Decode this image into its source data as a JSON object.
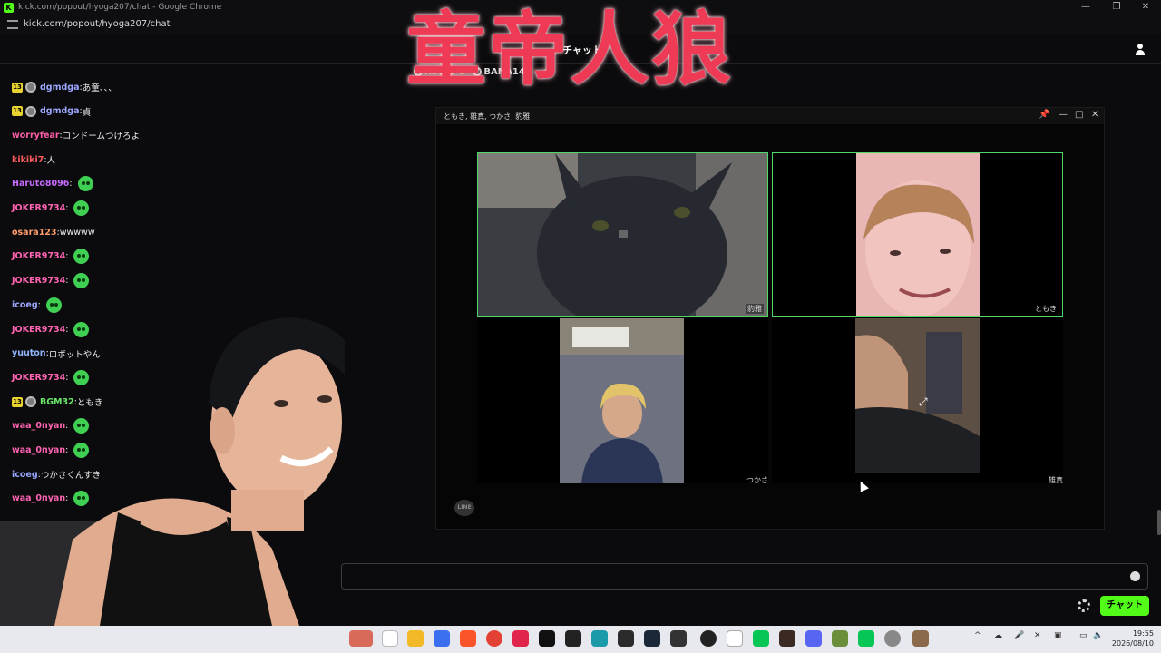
{
  "browser": {
    "window_title": "kick.com/popout/hyoga207/chat - Google Chrome",
    "url": "kick.com/popout/hyoga207/chat"
  },
  "chat_header": {
    "title": "チャット",
    "pinned_users": [
      "RIAKO 5",
      "BANA145"
    ]
  },
  "overlay_title": "童帝人狼",
  "messages": [
    {
      "badge": "13",
      "has_icon": true,
      "user": "dgmdga",
      "color": "#9aa7ff",
      "text": "あ童、、、"
    },
    {
      "badge": "13",
      "has_icon": true,
      "user": "dgmdga",
      "color": "#9aa7ff",
      "text": "貞"
    },
    {
      "user": "worryfear",
      "color": "#ff5fa8",
      "text": "コンドームつけろよ"
    },
    {
      "user": "kikiki7",
      "color": "#ff5d5d",
      "text": "人"
    },
    {
      "user": "Haruto8096",
      "color": "#c66bff",
      "text": "",
      "emote": true
    },
    {
      "user": "JOKER9734",
      "color": "#ff63b1",
      "text": "",
      "emote": true
    },
    {
      "user": "osara123",
      "color": "#ff9b6a",
      "text": "wwwww"
    },
    {
      "user": "JOKER9734",
      "color": "#ff63b1",
      "text": "",
      "emote": true
    },
    {
      "user": "JOKER9734",
      "color": "#ff63b1",
      "text": "",
      "emote": true
    },
    {
      "user": "icoeg",
      "color": "#9aa7ff",
      "text": "",
      "emote": true
    },
    {
      "user": "JOKER9734",
      "color": "#ff63b1",
      "text": "",
      "emote": true
    },
    {
      "user": "yuuton",
      "color": "#8fb5ff",
      "text": "ロボットやん"
    },
    {
      "user": "JOKER9734",
      "color": "#ff63b1",
      "text": "",
      "emote": true
    },
    {
      "badge": "13",
      "has_icon": true,
      "user": "BGM32",
      "color": "#6ae86a",
      "text": "ともき"
    },
    {
      "user": "waa_0nyan",
      "color": "#ff63b1",
      "text": "",
      "emote": true
    },
    {
      "user": "waa_0nyan",
      "color": "#ff63b1",
      "text": "",
      "emote": true
    },
    {
      "user": "icoeg",
      "color": "#9aa7ff",
      "text": "つかさくんすき"
    },
    {
      "user": "waa_0nyan",
      "color": "#ff63b1",
      "text": "",
      "emote": true
    }
  ],
  "call_window": {
    "title": "ともき, 雄真, つかさ, 豹雅",
    "tiles": [
      {
        "name": "豹雅"
      },
      {
        "name": "ともき"
      },
      {
        "name": "つかさ"
      },
      {
        "name": "雄真"
      }
    ],
    "app_badge": "LINE"
  },
  "chat_input": {
    "placeholder": "",
    "send_label": "チャット"
  },
  "taskbar": {
    "time": "19:55",
    "date": "2026/08/10"
  }
}
